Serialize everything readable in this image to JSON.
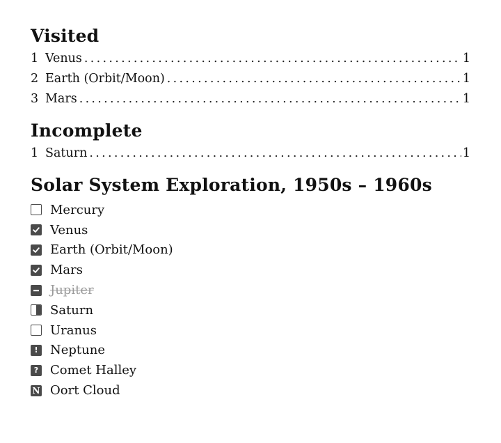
{
  "visited": {
    "heading": "Visited",
    "items": [
      {
        "num": "1",
        "title": "Venus",
        "page": "1"
      },
      {
        "num": "2",
        "title": "Earth (Orbit/Moon)",
        "page": "1"
      },
      {
        "num": "3",
        "title": "Mars",
        "page": "1"
      }
    ]
  },
  "incomplete": {
    "heading": "Incomplete",
    "items": [
      {
        "num": "1",
        "title": "Saturn",
        "page": "1"
      }
    ]
  },
  "exploration": {
    "heading": "Solar System Exploration, 1950s – 1960s",
    "tasks": [
      {
        "label": "Mercury",
        "status": "todo"
      },
      {
        "label": "Venus",
        "status": "done"
      },
      {
        "label": "Earth (Orbit/Moon)",
        "status": "done"
      },
      {
        "label": "Mars",
        "status": "done"
      },
      {
        "label": "Jupiter",
        "status": "cancelled"
      },
      {
        "label": "Saturn",
        "status": "in-progress"
      },
      {
        "label": "Uranus",
        "status": "todo"
      },
      {
        "label": "Neptune",
        "status": "important",
        "mark": "!"
      },
      {
        "label": "Comet Halley",
        "status": "question",
        "mark": "?"
      },
      {
        "label": "Oort Cloud",
        "status": "note",
        "mark": "N"
      }
    ]
  }
}
